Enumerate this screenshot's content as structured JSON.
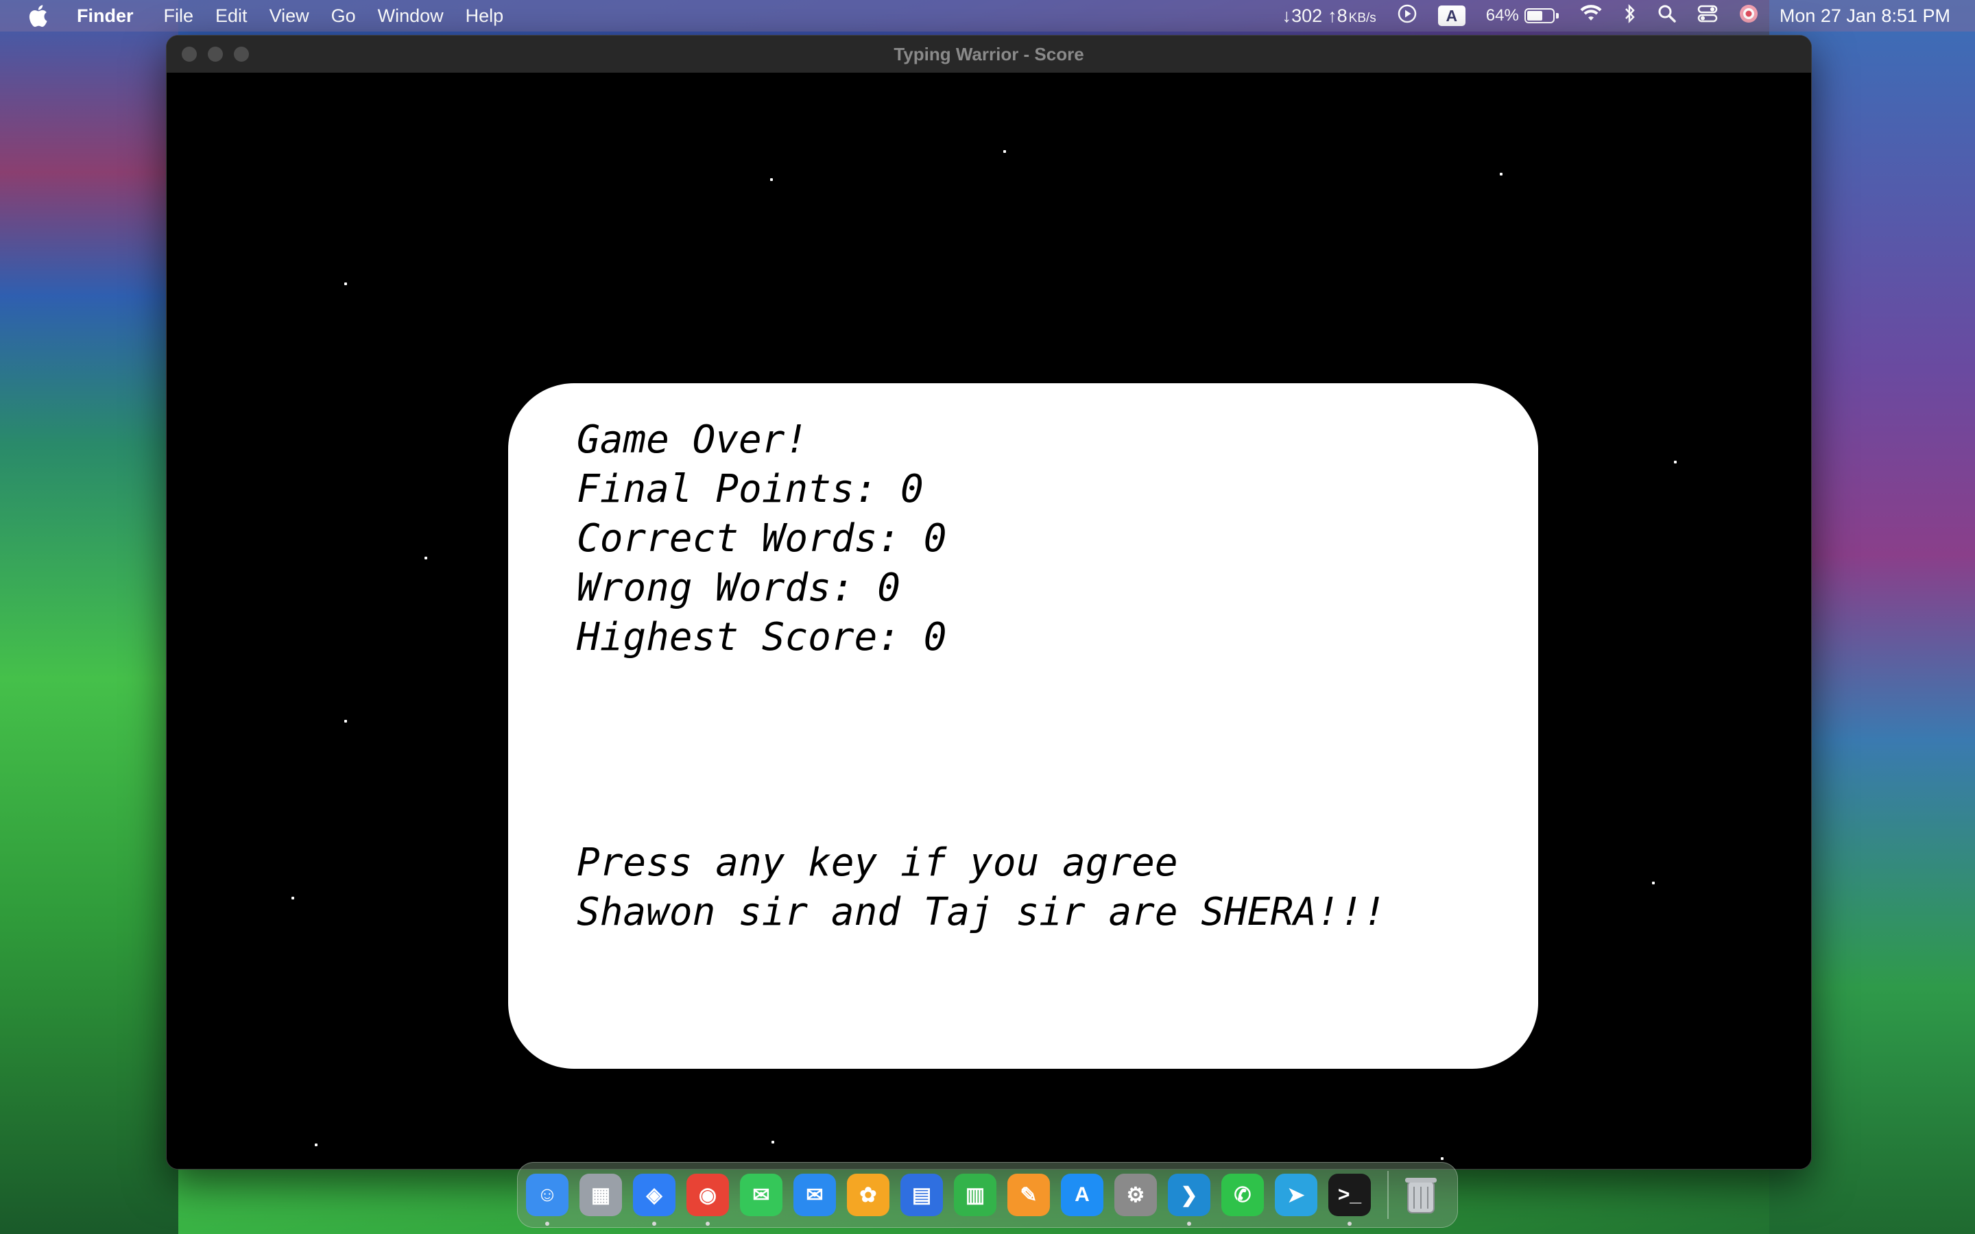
{
  "menubar": {
    "apple_icon": "apple-logo-icon",
    "app_name": "Finder",
    "items": [
      "File",
      "Edit",
      "View",
      "Go",
      "Window",
      "Help"
    ],
    "network": {
      "down": "↓302",
      "up": "↑8",
      "unit": "KB/s"
    },
    "input_source": "A",
    "battery_percent": "64%",
    "battery_level": 0.64,
    "clock": "Mon 27 Jan  8:51 PM",
    "status_icons": [
      "play-circle-icon",
      "wifi-icon",
      "bluetooth-icon",
      "search-icon",
      "control-center-icon",
      "user-avatar-icon"
    ]
  },
  "window": {
    "title": "Typing Warrior - Score"
  },
  "score": {
    "heading": "Game Over!",
    "final_points": "Final Points: 0",
    "correct_words": "Correct Words: 0",
    "wrong_words": "Wrong Words: 0",
    "highest_score": "Highest Score: 0",
    "prompt_line1": "Press any key if you agree",
    "prompt_line2": "Shawon sir and Taj sir are SHERA!!!"
  },
  "dock": {
    "apps": [
      {
        "name": "Finder",
        "icon": "finder-icon",
        "color": "#3a8ef0",
        "running": true
      },
      {
        "name": "Launchpad",
        "icon": "launchpad-icon",
        "color": "#9aa0a8",
        "running": false
      },
      {
        "name": "Safari",
        "icon": "safari-icon",
        "color": "#2f7ef5",
        "running": true
      },
      {
        "name": "Chrome",
        "icon": "chrome-icon",
        "color": "#e84335",
        "running": true
      },
      {
        "name": "Messages",
        "icon": "messages-icon",
        "color": "#35c759",
        "running": false
      },
      {
        "name": "Mail",
        "icon": "mail-icon",
        "color": "#2a8af0",
        "running": false
      },
      {
        "name": "Photos",
        "icon": "photos-icon",
        "color": "#f5a623",
        "running": false
      },
      {
        "name": "Keynote",
        "icon": "keynote-icon",
        "color": "#2f6fe0",
        "running": false
      },
      {
        "name": "Numbers",
        "icon": "numbers-icon",
        "color": "#33b34a",
        "running": false
      },
      {
        "name": "Pages",
        "icon": "pages-icon",
        "color": "#f5962a",
        "running": false
      },
      {
        "name": "App Store",
        "icon": "app-store-icon",
        "color": "#1e8ef5",
        "running": false
      },
      {
        "name": "System Settings",
        "icon": "system-settings-icon",
        "color": "#8a8a8a",
        "running": false
      },
      {
        "name": "VS Code",
        "icon": "vscode-icon",
        "color": "#1f8ad2",
        "running": true
      },
      {
        "name": "WhatsApp",
        "icon": "whatsapp-icon",
        "color": "#2fc24a",
        "running": false
      },
      {
        "name": "Telegram",
        "icon": "telegram-icon",
        "color": "#2aa3e0",
        "running": false
      },
      {
        "name": "Terminal exec",
        "icon": "terminal-exec-icon",
        "color": "#1a1a1a",
        "running": true
      }
    ],
    "trash": {
      "name": "Trash",
      "icon": "trash-icon"
    }
  }
}
